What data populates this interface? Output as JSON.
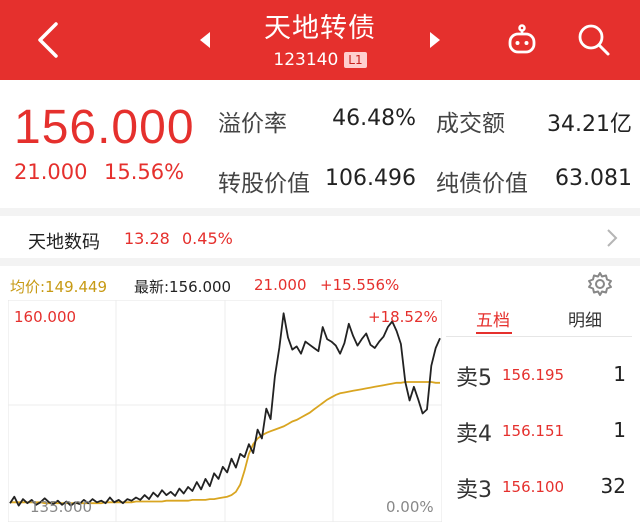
{
  "header": {
    "title": "天地转债",
    "code": "123140",
    "level_badge": "L1"
  },
  "quote": {
    "price": "156.000",
    "change": "21.000",
    "change_pct": "15.56%"
  },
  "stats": [
    {
      "label": "溢价率",
      "value": "46.48%"
    },
    {
      "label": "成交额",
      "value": "34.21亿"
    },
    {
      "label": "转股价值",
      "value": "106.496"
    },
    {
      "label": "纯债价值",
      "value": "63.081"
    }
  ],
  "related_stock": {
    "name": "天地数码",
    "price": "13.28",
    "pct": "0.45%"
  },
  "chart_info": {
    "avg": "均价:149.449",
    "latest": "最新:156.000",
    "change": "21.000",
    "change_pct": "+15.556%"
  },
  "chart_data": {
    "type": "line",
    "y_max_label": "160.000",
    "y_min_label": "135.000",
    "pct_max_label": "+18.52%",
    "pct_min_label": "0.00%",
    "ylim": [
      135.0,
      160.0
    ],
    "x": [
      0,
      1,
      2,
      3,
      4,
      5,
      6,
      7,
      8,
      9,
      10,
      11,
      12,
      13,
      14,
      15,
      16,
      17,
      18,
      19,
      20,
      21,
      22,
      23,
      24,
      25,
      26,
      27,
      28,
      29,
      30,
      31,
      32,
      33,
      34,
      35,
      36,
      37,
      38,
      39,
      40,
      41,
      42,
      43,
      44,
      45,
      46,
      47,
      48,
      49,
      50,
      51,
      52,
      53,
      54,
      55,
      56,
      57,
      58,
      59,
      60,
      61,
      62,
      63,
      64,
      65,
      66,
      67,
      68,
      69,
      70,
      71,
      72,
      73,
      74,
      75,
      76,
      77,
      78,
      79,
      80,
      81,
      82,
      83,
      84,
      85,
      86,
      87,
      88,
      89,
      90,
      91,
      92,
      93,
      94,
      95,
      96,
      97,
      98,
      99
    ],
    "series": [
      {
        "values": [
          135.6,
          136.4,
          135.3,
          136.1,
          135.6,
          136.0,
          135.4,
          135.7,
          136.2,
          135.7,
          135.5,
          135.9,
          135.4,
          135.8,
          135.3,
          135.7,
          135.5,
          136.0,
          135.6,
          136.1,
          135.7,
          135.9,
          135.6,
          136.3,
          135.7,
          136.0,
          135.6,
          136.1,
          135.9,
          136.3,
          136.0,
          136.6,
          136.1,
          136.9,
          136.4,
          137.2,
          136.6,
          137.0,
          136.5,
          137.4,
          136.8,
          137.6,
          137.1,
          138.2,
          137.3,
          138.6,
          137.7,
          139.3,
          138.6,
          140.1,
          139.4,
          141.1,
          140.0,
          141.7,
          141.3,
          142.9,
          141.8,
          144.7,
          143.6,
          147.3,
          146.0,
          151.3,
          154.8,
          159.1,
          156.1,
          154.6,
          155.0,
          154.1,
          155.6,
          155.2,
          154.8,
          154.4,
          157.4,
          155.9,
          155.6,
          155.1,
          154.1,
          155.4,
          157.8,
          156.3,
          155.1,
          155.9,
          156.6,
          155.2,
          154.8,
          155.6,
          156.2,
          157.4,
          158.1,
          156.9,
          155.3,
          150.6,
          148.3,
          150.0,
          148.4,
          146.7,
          147.2,
          152.6,
          154.8,
          156.0
        ]
      },
      {
        "values": [
          135.7,
          135.7,
          135.7,
          135.7,
          135.7,
          135.7,
          135.7,
          135.7,
          135.6,
          135.6,
          135.6,
          135.6,
          135.6,
          135.6,
          135.6,
          135.6,
          135.6,
          135.6,
          135.6,
          135.6,
          135.6,
          135.6,
          135.7,
          135.7,
          135.7,
          135.7,
          135.7,
          135.7,
          135.7,
          135.8,
          135.8,
          135.8,
          135.8,
          135.8,
          135.8,
          135.8,
          135.9,
          135.9,
          135.9,
          135.9,
          135.9,
          135.9,
          136.0,
          136.0,
          136.0,
          136.0,
          136.1,
          136.1,
          136.2,
          136.3,
          136.4,
          136.6,
          137.0,
          137.9,
          139.6,
          141.7,
          142.9,
          143.6,
          144.0,
          144.3,
          144.5,
          144.7,
          144.9,
          145.1,
          145.4,
          145.7,
          145.9,
          146.2,
          146.5,
          146.8,
          147.2,
          147.6,
          148.0,
          148.4,
          148.7,
          149.0,
          149.2,
          149.3,
          149.4,
          149.5,
          149.6,
          149.7,
          149.8,
          149.9,
          150.0,
          150.1,
          150.2,
          150.3,
          150.4,
          150.5,
          150.5,
          150.6,
          150.6,
          150.6,
          150.6,
          150.6,
          150.6,
          150.6,
          150.5,
          150.5
        ]
      }
    ]
  },
  "order_book": {
    "tabs": [
      "五档",
      "明细"
    ],
    "rows": [
      {
        "label": "卖5",
        "price": "156.195",
        "volume": "1"
      },
      {
        "label": "卖4",
        "price": "156.151",
        "volume": "1"
      },
      {
        "label": "卖3",
        "price": "156.100",
        "volume": "32"
      }
    ]
  },
  "colors": {
    "brand_red": "#e5302d",
    "avg_line": "#d9a521",
    "price_line": "#222222"
  },
  "icons": [
    "back-icon",
    "prev-icon",
    "next-icon",
    "robot-icon",
    "search-icon",
    "chevron-right-icon",
    "gear-icon"
  ]
}
